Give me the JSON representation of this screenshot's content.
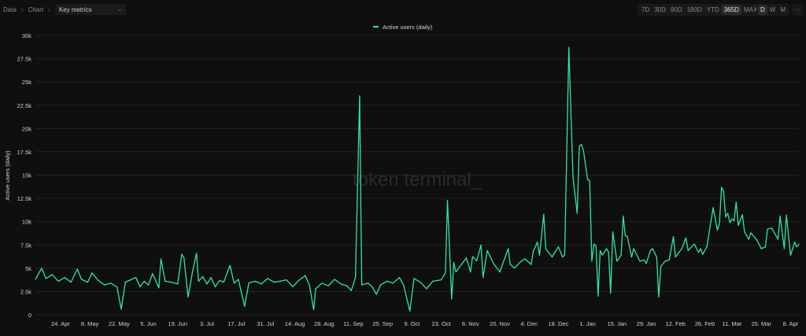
{
  "breadcrumb": {
    "items": [
      "Data",
      "Chart"
    ],
    "select_value": "Key metrics"
  },
  "toolbar": {
    "ranges": [
      "7D",
      "30D",
      "90D",
      "180D",
      "YTD",
      "365D",
      "MAX"
    ],
    "active_range": "365D",
    "granularity": [
      "D",
      "W",
      "M"
    ],
    "active_granularity": "D",
    "more_label": "···"
  },
  "watermark": "token terminal_",
  "colors": {
    "background": "#0f0f0f",
    "line": "#2ee6a3",
    "grid": "#232323"
  },
  "chart_data": {
    "type": "line",
    "title": "",
    "xlabel": "",
    "ylabel": "Active users (daily)",
    "legend": {
      "position": "top-center",
      "entries": [
        "Active users (daily)"
      ]
    },
    "grid": true,
    "ylim": [
      0,
      30000
    ],
    "y_ticks": [
      "0",
      "2.5k",
      "5k",
      "7.5k",
      "10k",
      "12.5k",
      "15k",
      "17.5k",
      "20k",
      "22.5k",
      "25k",
      "27.5k",
      "30k"
    ],
    "x_range": [
      "12 Apr",
      "12 Apr"
    ],
    "x_ticks": [
      "24. Apr",
      "8. May",
      "22. May",
      "5. Jun",
      "19. Jun",
      "3. Jul",
      "17. Jul",
      "31. Jul",
      "14. Aug",
      "28. Aug",
      "11. Sep",
      "25. Sep",
      "9. Oct",
      "23. Oct",
      "6. Nov",
      "20. Nov",
      "4. Dec",
      "18. Dec",
      "1. Jan",
      "15. Jan",
      "29. Jan",
      "12. Feb",
      "26. Feb",
      "11. Mar",
      "25. Mar",
      "8. Apr"
    ],
    "series": [
      {
        "name": "Active users (daily)",
        "points": [
          [
            "12 Apr",
            3800
          ],
          [
            "15 Apr",
            5000
          ],
          [
            "17 Apr",
            3900
          ],
          [
            "20 Apr",
            4300
          ],
          [
            "23 Apr",
            3600
          ],
          [
            "26 Apr",
            4000
          ],
          [
            "29 Apr",
            3500
          ],
          [
            "2 May",
            4900
          ],
          [
            "4 May",
            3800
          ],
          [
            "7 May",
            3500
          ],
          [
            "9 May",
            4500
          ],
          [
            "12 May",
            3700
          ],
          [
            "15 May",
            3200
          ],
          [
            "18 May",
            3400
          ],
          [
            "21 May",
            3000
          ],
          [
            "23 May",
            600
          ],
          [
            "25 May",
            3500
          ],
          [
            "28 May",
            3800
          ],
          [
            "30 May",
            4000
          ],
          [
            "1 Jun",
            3000
          ],
          [
            "3 Jun",
            3600
          ],
          [
            "5 Jun",
            3200
          ],
          [
            "7 Jun",
            4400
          ],
          [
            "10 Jun",
            2900
          ],
          [
            "11 Jun",
            6000
          ],
          [
            "13 Jun",
            3600
          ],
          [
            "16 Jun",
            3500
          ],
          [
            "19 Jun",
            3300
          ],
          [
            "21 Jun",
            6500
          ],
          [
            "22 Jun",
            6100
          ],
          [
            "24 Jun",
            1900
          ],
          [
            "26 Jun",
            4500
          ],
          [
            "28 Jun",
            6600
          ],
          [
            "29 Jun",
            3600
          ],
          [
            "1 Jul",
            4100
          ],
          [
            "3 Jul",
            3300
          ],
          [
            "5 Jul",
            4000
          ],
          [
            "7 Jul",
            3000
          ],
          [
            "9 Jul",
            3700
          ],
          [
            "11 Jul",
            3500
          ],
          [
            "14 Jul",
            5300
          ],
          [
            "16 Jul",
            3400
          ],
          [
            "18 Jul",
            3800
          ],
          [
            "21 Jul",
            900
          ],
          [
            "23 Jul",
            3400
          ],
          [
            "26 Jul",
            3600
          ],
          [
            "29 Jul",
            3300
          ],
          [
            "1 Aug",
            3900
          ],
          [
            "4 Aug",
            3500
          ],
          [
            "7 Aug",
            3600
          ],
          [
            "10 Aug",
            3750
          ],
          [
            "13 Aug",
            3000
          ],
          [
            "16 Aug",
            3700
          ],
          [
            "19 Aug",
            4200
          ],
          [
            "21 Aug",
            3200
          ],
          [
            "23 Aug",
            550
          ],
          [
            "24 Aug",
            2800
          ],
          [
            "27 Aug",
            3400
          ],
          [
            "30 Aug",
            3100
          ],
          [
            "2 Sep",
            3800
          ],
          [
            "5 Sep",
            3300
          ],
          [
            "8 Sep",
            3100
          ],
          [
            "10 Sep",
            2600
          ],
          [
            "12 Sep",
            4000
          ],
          [
            "14 Sep",
            23500
          ],
          [
            "15 Sep",
            3200
          ],
          [
            "18 Sep",
            3400
          ],
          [
            "20 Sep",
            3000
          ],
          [
            "22 Sep",
            2200
          ],
          [
            "24 Sep",
            3200
          ],
          [
            "27 Sep",
            3600
          ],
          [
            "30 Sep",
            3400
          ],
          [
            "3 Oct",
            4000
          ],
          [
            "5 Oct",
            3200
          ],
          [
            "8 Oct",
            400
          ],
          [
            "10 Oct",
            3900
          ],
          [
            "13 Oct",
            3500
          ],
          [
            "16 Oct",
            2800
          ],
          [
            "19 Oct",
            3600
          ],
          [
            "23 Oct",
            3750
          ],
          [
            "25 Oct",
            4500
          ],
          [
            "26 Oct",
            12300
          ],
          [
            "28 Oct",
            1700
          ],
          [
            "29 Oct",
            5600
          ],
          [
            "30 Oct",
            4600
          ],
          [
            "2 Nov",
            5500
          ],
          [
            "4 Nov",
            6100
          ],
          [
            "6 Nov",
            4600
          ],
          [
            "7 Nov",
            6250
          ],
          [
            "9 Nov",
            5800
          ],
          [
            "11 Nov",
            7500
          ],
          [
            "12 Nov",
            4000
          ],
          [
            "14 Nov",
            6900
          ],
          [
            "17 Nov",
            5500
          ],
          [
            "20 Nov",
            4600
          ],
          [
            "24 Nov",
            7100
          ],
          [
            "25 Nov",
            5400
          ],
          [
            "27 Nov",
            5000
          ],
          [
            "30 Nov",
            5700
          ],
          [
            "2 Dec",
            6000
          ],
          [
            "5 Dec",
            5400
          ],
          [
            "6 Dec",
            6800
          ],
          [
            "8 Dec",
            7800
          ],
          [
            "9 Dec",
            6400
          ],
          [
            "11 Dec",
            10800
          ],
          [
            "12 Dec",
            7100
          ],
          [
            "15 Dec",
            6200
          ],
          [
            "18 Dec",
            7300
          ],
          [
            "20 Dec",
            6200
          ],
          [
            "21 Dec",
            6400
          ],
          [
            "23 Dec",
            28700
          ],
          [
            "25 Dec",
            14800
          ],
          [
            "27 Dec",
            10900
          ],
          [
            "28 Dec",
            18100
          ],
          [
            "29 Dec",
            18300
          ],
          [
            "30 Dec",
            17600
          ],
          [
            "1 Jan",
            14500
          ],
          [
            "2 Jan",
            14400
          ],
          [
            "3 Jan",
            5750
          ],
          [
            "4 Jan",
            7600
          ],
          [
            "5 Jan",
            7400
          ],
          [
            "6 Jan",
            2000
          ],
          [
            "7 Jan",
            6900
          ],
          [
            "8 Jan",
            6400
          ],
          [
            "10 Jan",
            7100
          ],
          [
            "11 Jan",
            6700
          ],
          [
            "12 Jan",
            2300
          ],
          [
            "13 Jan",
            8900
          ],
          [
            "15 Jan",
            5750
          ],
          [
            "17 Jan",
            6400
          ],
          [
            "18 Jan",
            10600
          ],
          [
            "19 Jan",
            8500
          ],
          [
            "20 Jan",
            8400
          ],
          [
            "22 Jan",
            6200
          ],
          [
            "23 Jan",
            7100
          ],
          [
            "26 Jan",
            5750
          ],
          [
            "28 Jan",
            5900
          ],
          [
            "29 Jan",
            5500
          ],
          [
            "31 Jan",
            6900
          ],
          [
            "1 Feb",
            7100
          ],
          [
            "3 Feb",
            6200
          ],
          [
            "4 Feb",
            1900
          ],
          [
            "5 Feb",
            5200
          ],
          [
            "7 Feb",
            5750
          ],
          [
            "9 Feb",
            5900
          ],
          [
            "11 Feb",
            8400
          ],
          [
            "12 Feb",
            6200
          ],
          [
            "15 Feb",
            7100
          ],
          [
            "17 Feb",
            8250
          ],
          [
            "18 Feb",
            6900
          ],
          [
            "21 Feb",
            7600
          ],
          [
            "23 Feb",
            6700
          ],
          [
            "24 Feb",
            7100
          ],
          [
            "25 Feb",
            6500
          ],
          [
            "27 Feb",
            7300
          ],
          [
            "2 Mar",
            11500
          ],
          [
            "4 Mar",
            9100
          ],
          [
            "5 Mar",
            9800
          ],
          [
            "6 Mar",
            13700
          ],
          [
            "7 Mar",
            13200
          ],
          [
            "8 Mar",
            10500
          ],
          [
            "9 Mar",
            10900
          ],
          [
            "10 Mar",
            9900
          ],
          [
            "11 Mar",
            10300
          ],
          [
            "12 Mar",
            10100
          ],
          [
            "13 Mar",
            12100
          ],
          [
            "14 Mar",
            9600
          ],
          [
            "16 Mar",
            10750
          ],
          [
            "17 Mar",
            8900
          ],
          [
            "19 Mar",
            8100
          ],
          [
            "20 Mar",
            8800
          ],
          [
            "23 Mar",
            8000
          ],
          [
            "25 Mar",
            7100
          ],
          [
            "27 Mar",
            7300
          ],
          [
            "28 Mar",
            9200
          ],
          [
            "30 Mar",
            9300
          ],
          [
            "2 Apr",
            8100
          ],
          [
            "3 Apr",
            10600
          ],
          [
            "5 Apr",
            7100
          ],
          [
            "6 Apr",
            10700
          ],
          [
            "8 Apr",
            6400
          ],
          [
            "10 Apr",
            7800
          ],
          [
            "11 Apr",
            7300
          ],
          [
            "12 Apr",
            7600
          ]
        ]
      }
    ]
  }
}
